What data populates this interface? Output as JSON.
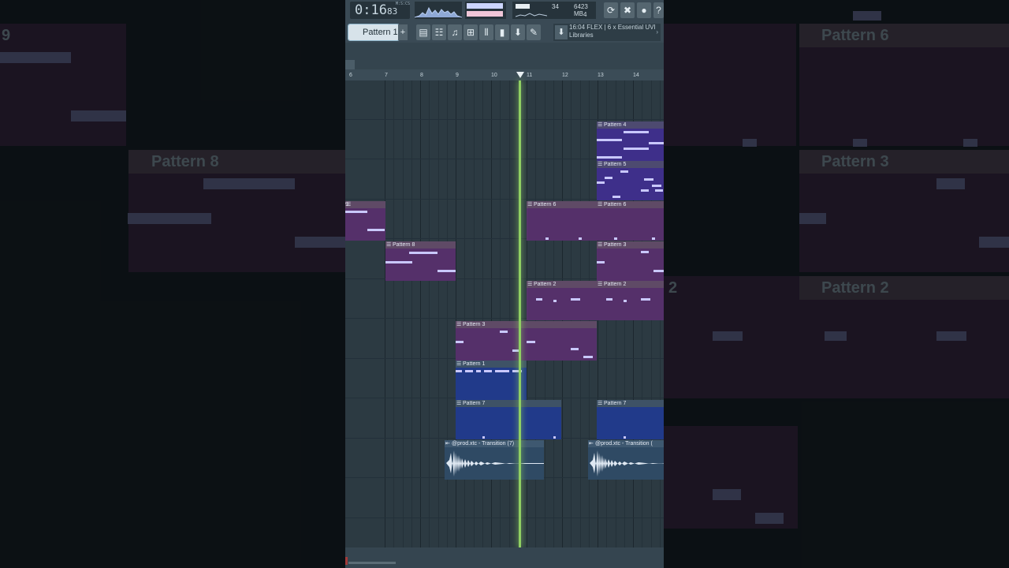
{
  "toolbar": {
    "time": "0:16",
    "time_sub": "83",
    "time_mode": "M:S:CS",
    "cpu": "34",
    "memory": "6423 MB",
    "polyphony": "4",
    "pattern_selector": "Pattern 1",
    "add_pattern": "+",
    "news_time": "16:04",
    "news_text_line1": "FLEX | 6 x Essential UVI",
    "news_text_line2": "Libraries"
  },
  "ruler": [
    "6",
    "7",
    "8",
    "9",
    "10",
    "11",
    "12",
    "13",
    "14"
  ],
  "clips": {
    "p4": "Pattern 4",
    "p5": "Pattern 5",
    "p9": "9",
    "p6a": "Pattern 6",
    "p6b": "Pattern 6",
    "p8": "Pattern 8",
    "p3a": "Pattern 3",
    "p2a": "Pattern 2",
    "p2b": "Pattern 2",
    "p3b": "Pattern 3",
    "p1": "Pattern 1",
    "p7a": "Pattern 7",
    "p7b": "Pattern 7",
    "a1": "@prod.xtc - Transition (7)",
    "a2": "@prod.xtc - Transition ("
  },
  "background": {
    "left_label": "Pattern 8",
    "left_num": "9",
    "right_label1": "Pattern 6",
    "right_label2": "Pattern 3",
    "right_label3": "Pattern 2",
    "right_num1": "6",
    "right_num2": "2"
  },
  "colors": {
    "playhead": "#8fcf63",
    "clip_purple": "#55306a",
    "clip_blue": "#213a8a"
  }
}
